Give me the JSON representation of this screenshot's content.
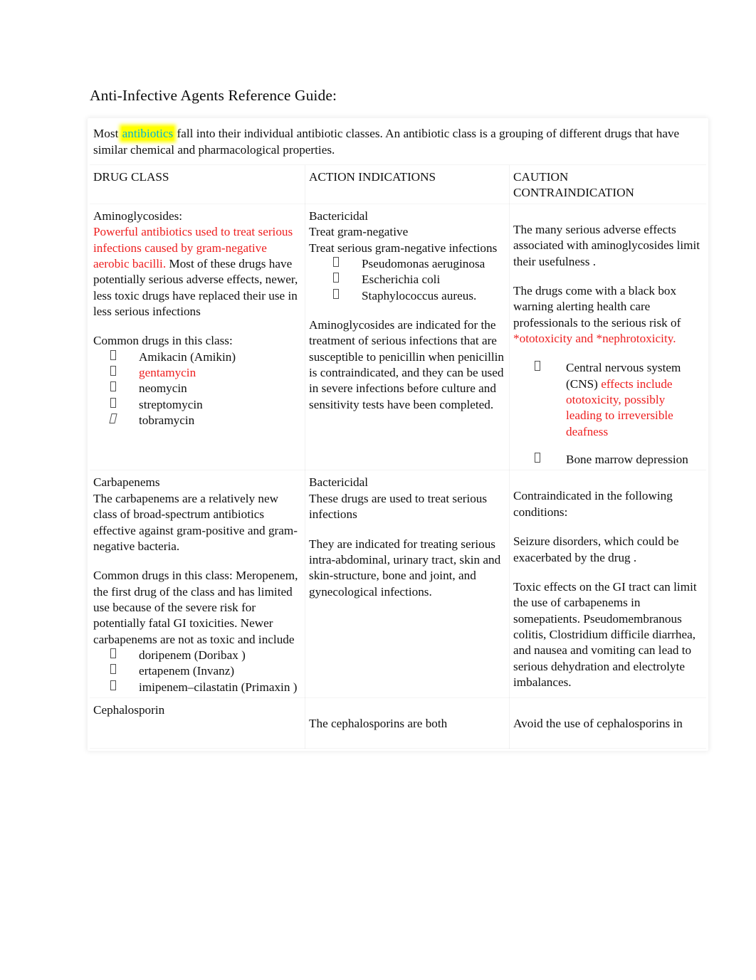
{
  "document": {
    "title": "Anti-Infective Agents Reference Guide:",
    "intro": {
      "before": "Most ",
      "highlight": "antibiotics",
      "after": " fall into their individual antibiotic classes. An antibiotic class is a grouping of different drugs that have similar chemical and pharmacological properties."
    },
    "colors": {
      "highlight_bg": "#ffff00",
      "highlight_text": "#00b5d4",
      "emphasis_red": "#ee2020",
      "body_text": "#101010",
      "page_bg": "#ffffff"
    },
    "table": {
      "headers": {
        "col1": "DRUG CLASS",
        "col2": "ACTION INDICATIONS",
        "col3_line1": "CAUTION",
        "col3_line2": "CONTRAINDICATION"
      },
      "rows": [
        {
          "drug_class": {
            "heading": "Aminoglycosides:",
            "red_text": "Powerful antibiotics used to treat serious infections caused by gram-negative aerobic bacilli.",
            "black_text": " Most of these drugs have potentially serious adverse effects, newer, less toxic drugs have replaced their use in less serious infections",
            "list_intro": "Common drugs in this class:",
            "drugs": [
              {
                "name": "Amikacin (Amikin)",
                "red": false,
                "italic_bullet": false
              },
              {
                "name": "gentamycin",
                "red": true,
                "italic_bullet": false
              },
              {
                "name": "neomycin",
                "red": false,
                "italic_bullet": false
              },
              {
                "name": "streptomycin",
                "red": false,
                "italic_bullet": false
              },
              {
                "name": "tobramycin",
                "red": false,
                "italic_bullet": true
              }
            ]
          },
          "action_indications": {
            "line1": "Bactericidal",
            "line2": "Treat gram-negative",
            "line3": "Treat serious gram-negative infections",
            "organisms": [
              "Pseudomonas aeruginosa",
              "Escherichia coli",
              "Staphylococcus aureus."
            ],
            "paragraph": "Aminoglycosides are indicated for the treatment of serious infections that are susceptible to penicillin when penicillin is contraindicated, and they can be used in severe infections before culture and sensitivity tests have been completed."
          },
          "caution": {
            "para1": "The many serious adverse effects associated with aminoglycosides limit their usefulness  .",
            "para2_black": "The drugs come with a black box warning alerting health care professionals to the serious risk of ",
            "para2_red": "*ototoxicity and *nephrotoxicity.",
            "bullets": [
              {
                "black": "Central nervous system (CNS) ",
                "red": "effects include ototoxicity, possibly leading to irreversible deafness"
              },
              {
                "black": "Bone marrow depression",
                "red": ""
              }
            ]
          }
        },
        {
          "drug_class": {
            "heading": "Carbapenems",
            "para1": "The carbapenems are a relatively new class of broad-spectrum antibiotics effective against gram-positive and gram-negative bacteria.",
            "para2": "Common drugs in this class: Meropenem, the first drug of the class and has limited use because of the severe risk for potentially fatal GI toxicities. Newer carbapenems are not as toxic and include",
            "drugs": [
              "doripenem (Doribax )",
              "ertapenem (Invanz)",
              " imipenem–cilastatin (Primaxin )"
            ]
          },
          "action_indications": {
            "line1": "Bactericidal",
            "line2": "These drugs are used to treat serious infections",
            "paragraph": "They are indicated for treating serious intra-abdominal, urinary tract, skin and skin-structure, bone and joint, and gynecological infections."
          },
          "caution": {
            "para1": "Contraindicated in the following conditions:",
            "para2": "Seizure disorders, which could be exacerbated by the drug .",
            "para3": "Toxic effects on the GI tract can limit the use of carbapenems in somepatients. Pseudomembranous colitis, Clostridium difficile diarrhea, and nausea and vomiting can lead to serious dehydration and electrolyte imbalances."
          }
        },
        {
          "drug_class": {
            "heading": "Cephalosporin"
          },
          "action_indications": {
            "line1": "The cephalosporins are both"
          },
          "caution": {
            "para1": "Avoid the use of cephalosporins in"
          }
        }
      ]
    }
  }
}
